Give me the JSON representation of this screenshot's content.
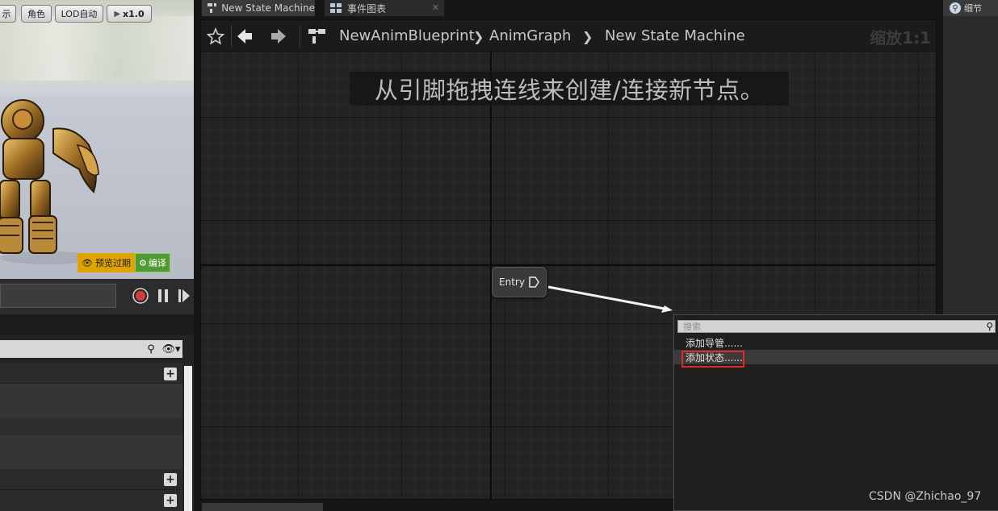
{
  "viewport": {
    "buttons": [
      "示",
      "角色",
      "LOD自动",
      "x1.0"
    ],
    "preview_warning": "预览过期",
    "compile_label": "编译"
  },
  "tabs": [
    {
      "label": "New State Machine",
      "icon": "state-machine-icon"
    },
    {
      "label": "事件图表",
      "icon": "event-graph-icon"
    }
  ],
  "toolbar": {
    "breadcrumbs": [
      "NewAnimBlueprint",
      "AnimGraph",
      "New State Machine"
    ],
    "zoom": "缩放1:1"
  },
  "graph": {
    "hint": "从引脚拖拽连线来创建/连接新节点。",
    "entry_label": "Entry"
  },
  "details": {
    "tab_label": "细节"
  },
  "context_menu": {
    "search_placeholder": "搜索",
    "items": [
      "添加导管......",
      "添加状态......"
    ]
  },
  "colors": {
    "highlight": "#e2282b",
    "warning": "#e0a400",
    "compile": "#4f9a32"
  },
  "watermark": "CSDN @Zhichao_97"
}
